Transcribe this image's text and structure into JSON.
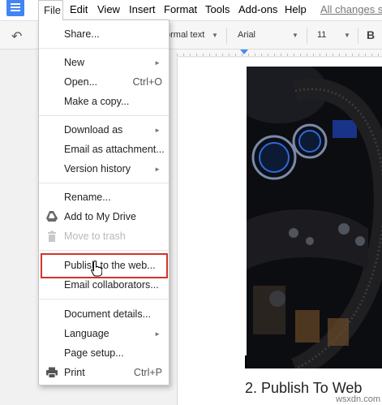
{
  "menubar": {
    "items": [
      "File",
      "Edit",
      "View",
      "Insert",
      "Format",
      "Tools",
      "Add-ons",
      "Help"
    ],
    "status": "All changes sa"
  },
  "toolbar": {
    "style": "ormal text",
    "font": "Arial",
    "size": "11",
    "bold": "B"
  },
  "file_menu": {
    "share": "Share...",
    "new": "New",
    "open": "Open...",
    "open_shortcut": "Ctrl+O",
    "make_copy": "Make a copy...",
    "download_as": "Download as",
    "email_attachment": "Email as attachment...",
    "version_history": "Version history",
    "rename": "Rename...",
    "add_to_drive": "Add to My Drive",
    "move_to_trash": "Move to trash",
    "publish": "Publish to the web...",
    "email_collaborators": "Email collaborators...",
    "document_details": "Document details...",
    "language": "Language",
    "page_setup": "Page setup...",
    "print": "Print",
    "print_shortcut": "Ctrl+P"
  },
  "document": {
    "heading": "2. Publish To Web"
  },
  "watermark": "wsxdn.com",
  "colors": {
    "highlight": "#d0342c",
    "docs_blue": "#4285f4"
  }
}
